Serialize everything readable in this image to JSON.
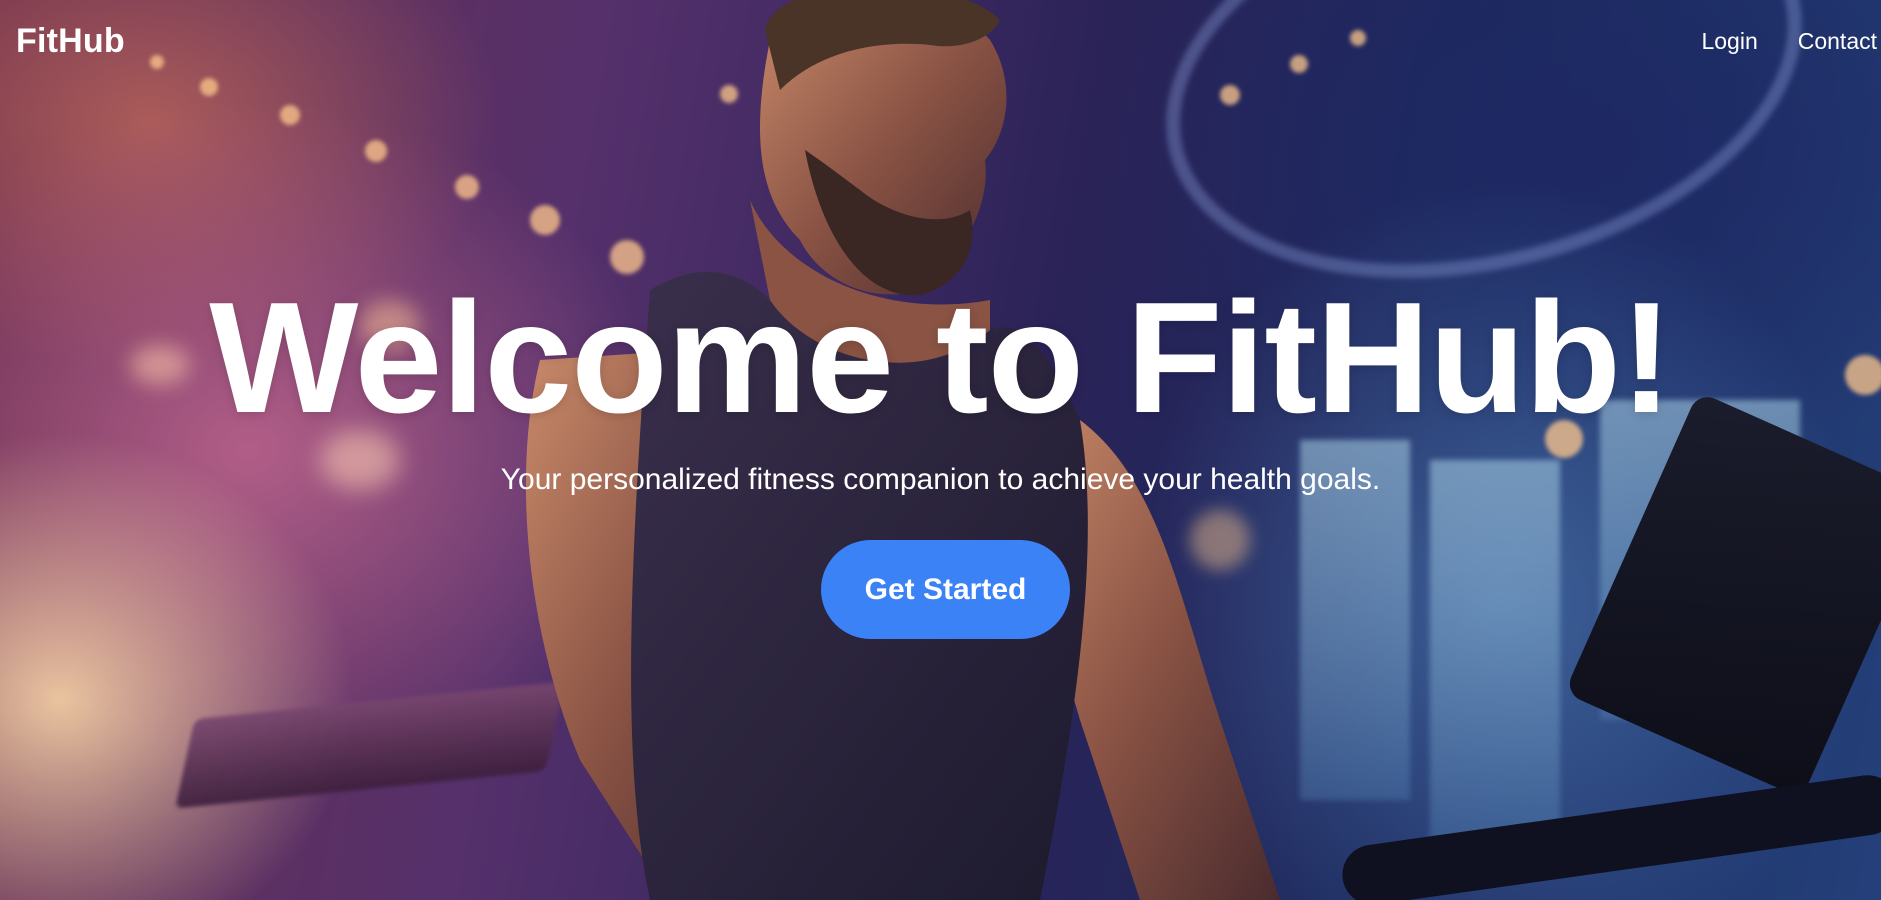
{
  "navbar": {
    "logo": "FitHub",
    "links": [
      {
        "label": "Login"
      },
      {
        "label": "Contact"
      }
    ]
  },
  "hero": {
    "headline": "Welcome to FitHub!",
    "subtitle": "Your personalized fitness companion to achieve your health goals.",
    "cta_label": "Get Started"
  },
  "colors": {
    "cta_background": "#3b82f6",
    "text": "#ffffff"
  },
  "background_image": "gym-athlete-photo"
}
